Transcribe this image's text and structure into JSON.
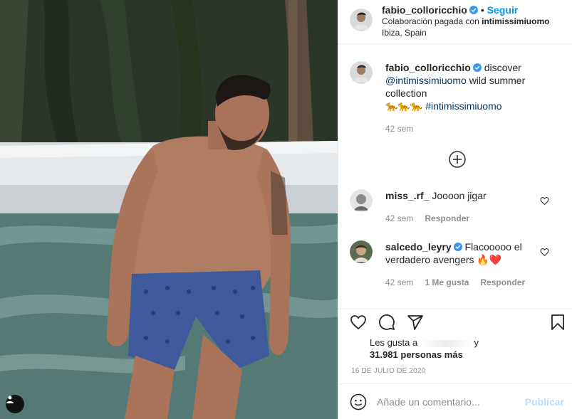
{
  "post": {
    "author": "fabio_colloricchio",
    "follow_label": "Seguir",
    "partnership_prefix": "Colaboración pagada con ",
    "partner": "intimissimiuomo",
    "location": "Ibiza, Spain",
    "caption_text": "discover",
    "caption_mention": "@intimissimiuomo",
    "caption_rest": "wild summer collection",
    "caption_emojis": "🐆🐆🐆",
    "caption_hashtag": "#intimissimiuomo",
    "caption_time": "42 sem"
  },
  "comments": [
    {
      "user": "miss_.rf_",
      "text": "Joooon jigar",
      "time": "42 sem",
      "reply_label": "Responder"
    },
    {
      "user": "salcedo_leyry",
      "text": "Flacooooo el verdadero avengers 🔥❤️",
      "time": "42 sem",
      "likes_label": "1 Me gusta",
      "reply_label": "Responder"
    }
  ],
  "likes": {
    "prefix": "Les gusta a",
    "connector": "y",
    "count": "31.981 personas más"
  },
  "date": "16 DE JULIO DE 2020",
  "composer": {
    "placeholder": "Añade un comentario...",
    "publish_label": "Publicar"
  },
  "colors": {
    "accent": "#0095f6",
    "verified": "#3897f0",
    "publish_disabled": "#b2dffc",
    "secondary_text": "#8e8e8e"
  },
  "icons": [
    "verified-badge-icon",
    "more-options-icon",
    "plus-circle-icon",
    "heart-icon",
    "comment-icon",
    "share-icon",
    "bookmark-icon",
    "emoji-icon",
    "user-tag-icon"
  ]
}
